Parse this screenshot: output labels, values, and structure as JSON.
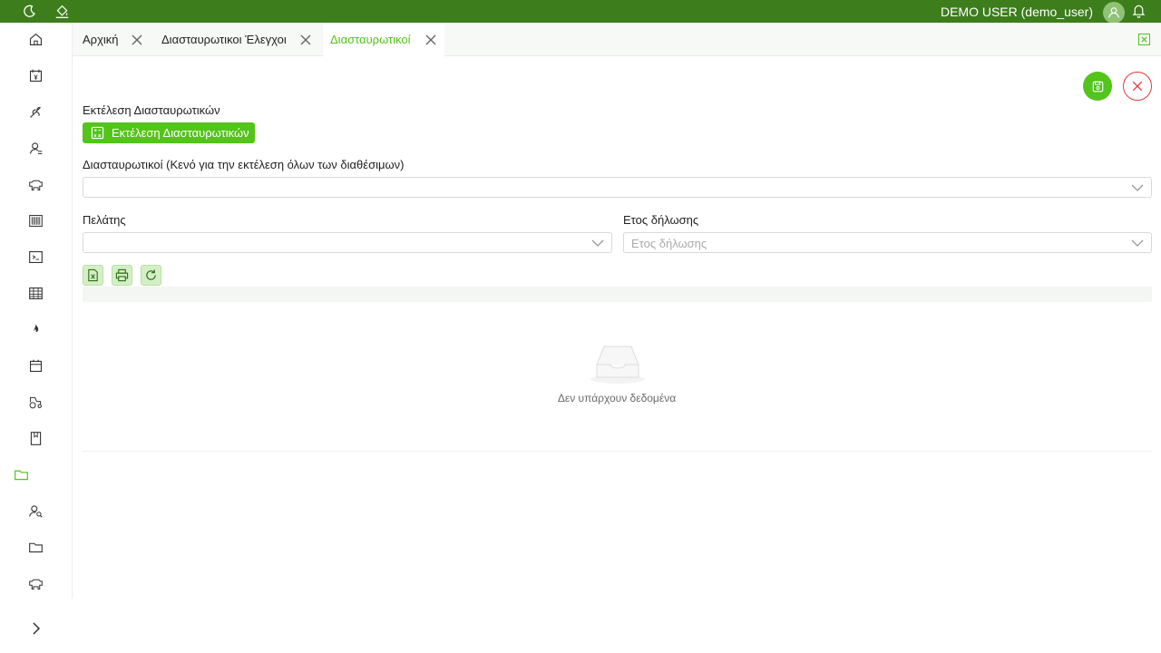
{
  "topbar": {
    "user": "DEMO USER (demo_user)",
    "icons": [
      "moon-icon",
      "paint-bucket-icon",
      "user-avatar-icon",
      "bell-icon"
    ]
  },
  "sidebar": {
    "items": [
      {
        "icon": "home-icon"
      },
      {
        "icon": "invoice-icon"
      },
      {
        "icon": "plant-icon"
      },
      {
        "icon": "user-list-icon"
      },
      {
        "icon": "livestock-icon"
      },
      {
        "icon": "barcode-icon"
      },
      {
        "icon": "terminal-icon"
      },
      {
        "icon": "table-icon"
      },
      {
        "icon": "fire-icon"
      },
      {
        "icon": "calendar-icon"
      },
      {
        "icon": "tractor-icon"
      },
      {
        "icon": "book-icon"
      },
      {
        "icon": "folder-icon",
        "active": true
      },
      {
        "icon": "user-search-icon"
      },
      {
        "icon": "folder-icon"
      },
      {
        "icon": "livestock-icon"
      }
    ],
    "expand_icon": "chevron-right-icon"
  },
  "tabs": [
    {
      "label": "Αρχική",
      "active": false
    },
    {
      "label": "Διασταυρωτικοι Έλεγχοι",
      "active": false
    },
    {
      "label": "Διασταυρωτικοί",
      "active": true
    }
  ],
  "form": {
    "run_section_label": "Εκτέλεση Διασταυρωτικών",
    "run_button_label": "Εκτέλεση Διασταυρωτικών",
    "cross_checks_label": "Διασταυρωτικοί (Κενό για την εκτέλεση όλων των διαθέσιμων)",
    "cross_checks_value": "",
    "customer_label": "Πελάτης",
    "customer_value": "",
    "year_label": "Ετος δήλωσης",
    "year_placeholder": "Ετος δήλωσης"
  },
  "grid": {
    "empty_text": "Δεν υπάρχουν δεδομένα"
  },
  "colors": {
    "topbar": "#3d7d1c",
    "accent": "#52c41a",
    "danger": "#e03a3a"
  }
}
